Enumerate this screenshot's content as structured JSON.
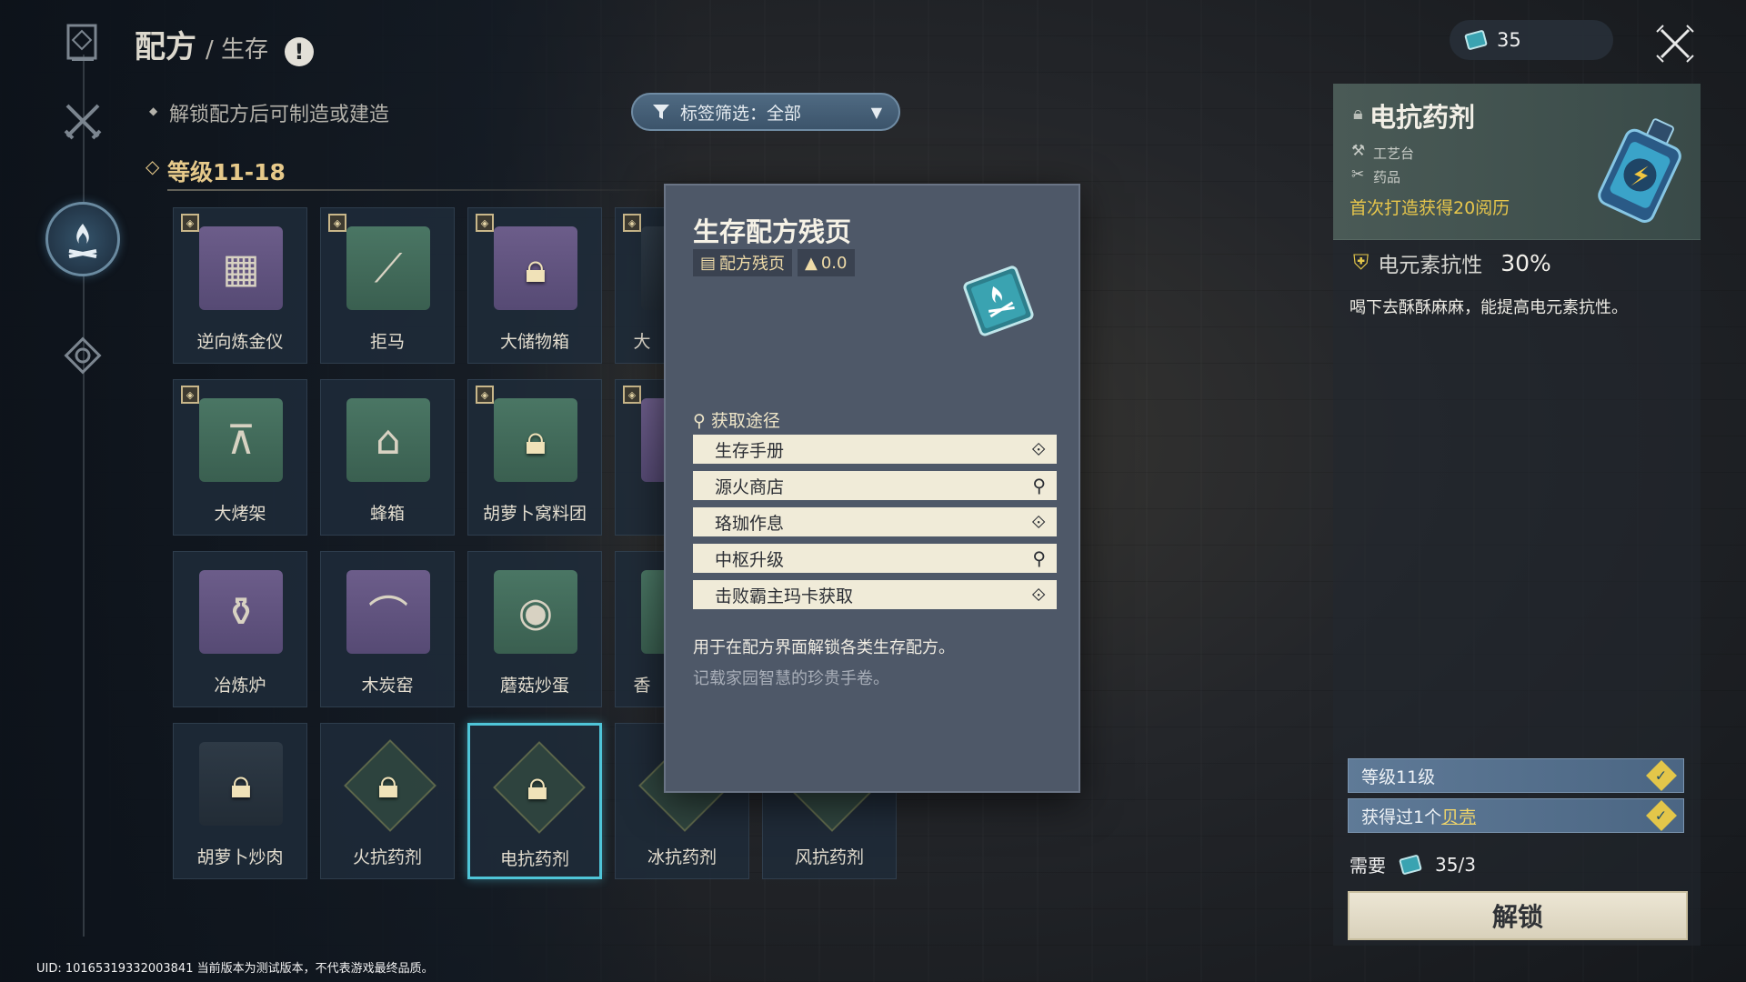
{
  "header": {
    "title": "配方",
    "subtitle": "/ 生存",
    "info_icon": "!"
  },
  "hint": "解锁配方后可制造或建造",
  "filter": {
    "label": "标签筛选：全部",
    "icon": "funnel-icon"
  },
  "level_section": "等级11-18",
  "rail": [
    "recipe-book-icon",
    "crossed-swords-icon",
    "campfire-icon",
    "gear-diamond-icon"
  ],
  "grid": {
    "items": [
      {
        "label": "逆向炼金仪",
        "icon": "▦",
        "color": "purple",
        "badge": true
      },
      {
        "label": "拒马",
        "icon": "⟋",
        "color": "green",
        "badge": true
      },
      {
        "label": "大储物箱",
        "icon": "🔒",
        "color": "purple",
        "badge": true,
        "locked": true
      },
      {
        "label": "大",
        "icon": "",
        "color": "dark",
        "badge": true
      },
      {
        "label": "大烤架",
        "icon": "⊼",
        "color": "green",
        "badge": true
      },
      {
        "label": "蜂箱",
        "icon": "⌂",
        "color": "green",
        "badge": false
      },
      {
        "label": "胡萝卜窝料团",
        "icon": "🔒",
        "color": "green",
        "badge": true,
        "locked": true
      },
      {
        "label": "",
        "icon": "",
        "color": "purple",
        "badge": true
      },
      {
        "label": "冶炼炉",
        "icon": "⚱",
        "color": "purple",
        "badge": false
      },
      {
        "label": "木炭窑",
        "icon": "⌒",
        "color": "purple",
        "badge": false
      },
      {
        "label": "蘑菇炒蛋",
        "icon": "◉",
        "color": "green",
        "badge": false
      },
      {
        "label": "香",
        "icon": "",
        "color": "green",
        "badge": false
      },
      {
        "label": "胡萝卜炒肉",
        "icon": "🔒",
        "color": "dark",
        "badge": false,
        "locked": true
      },
      {
        "label": "火抗药剂",
        "icon": "🔒",
        "color": "diamond",
        "badge": false,
        "locked": true
      },
      {
        "label": "电抗药剂",
        "icon": "🔒",
        "color": "diamond",
        "badge": false,
        "locked": true,
        "selected": true
      },
      {
        "label": "冰抗药剂",
        "icon": "",
        "color": "diamond",
        "badge": false
      },
      {
        "label": "风抗药剂",
        "icon": "",
        "color": "diamond",
        "badge": false
      }
    ]
  },
  "popup": {
    "title": "生存配方残页",
    "tag1": "配方残页",
    "tag2": "0.0",
    "source_title": "获取途径",
    "sources": [
      {
        "label": "生存手册",
        "icon": "arrow-diamond-icon"
      },
      {
        "label": "源火商店",
        "icon": "map-pin-icon"
      },
      {
        "label": "珞珈作息",
        "icon": "arrow-diamond-icon"
      },
      {
        "label": "中枢升级",
        "icon": "map-pin-icon"
      },
      {
        "label": "击败霸主玛卡获取",
        "icon": "arrow-diamond-icon"
      }
    ],
    "description": "用于在配方界面解锁各类生存配方。",
    "flavor": "记载家园智慧的珍贵手卷。"
  },
  "detail": {
    "title": "电抗药剂",
    "station": "工艺台",
    "category": "药品",
    "first_craft": "首次打造获得20阅历",
    "stat_label": "电元素抗性",
    "stat_value": "30%",
    "description": "喝下去酥酥麻麻，能提高电元素抗性。",
    "req1": "等级11级",
    "req2_prefix": "获得过1个",
    "req2_link": "贝壳",
    "need_label": "需要",
    "need_value": "35/3",
    "unlock": "解锁"
  },
  "currency": {
    "value": "35"
  },
  "uid": "UID: 10165319332003841 当前版本为测试版本，不代表游戏最终品质。",
  "colors": {
    "accent": "#4fc5d8",
    "gold": "#e7c64b",
    "popup_bg": "#4e5868"
  }
}
